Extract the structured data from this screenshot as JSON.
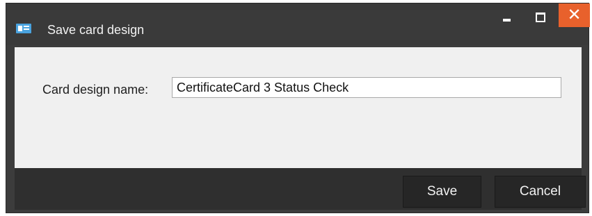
{
  "window": {
    "title": "Save card design",
    "icon": "id-card-icon",
    "controls": {
      "minimize_icon": "minimize-icon",
      "maximize_icon": "maximize-icon",
      "close_glyph": "✕"
    }
  },
  "form": {
    "name_label": "Card design name:",
    "name_value": "CertificateCard 3 Status Check"
  },
  "footer": {
    "save_label": "Save",
    "cancel_label": "Cancel"
  },
  "colors": {
    "titlebar": "#3a3a3a",
    "content": "#f0f0f0",
    "footer": "#2f2f2f",
    "close_button": "#e8612c",
    "icon_accent": "#4aa3df"
  }
}
